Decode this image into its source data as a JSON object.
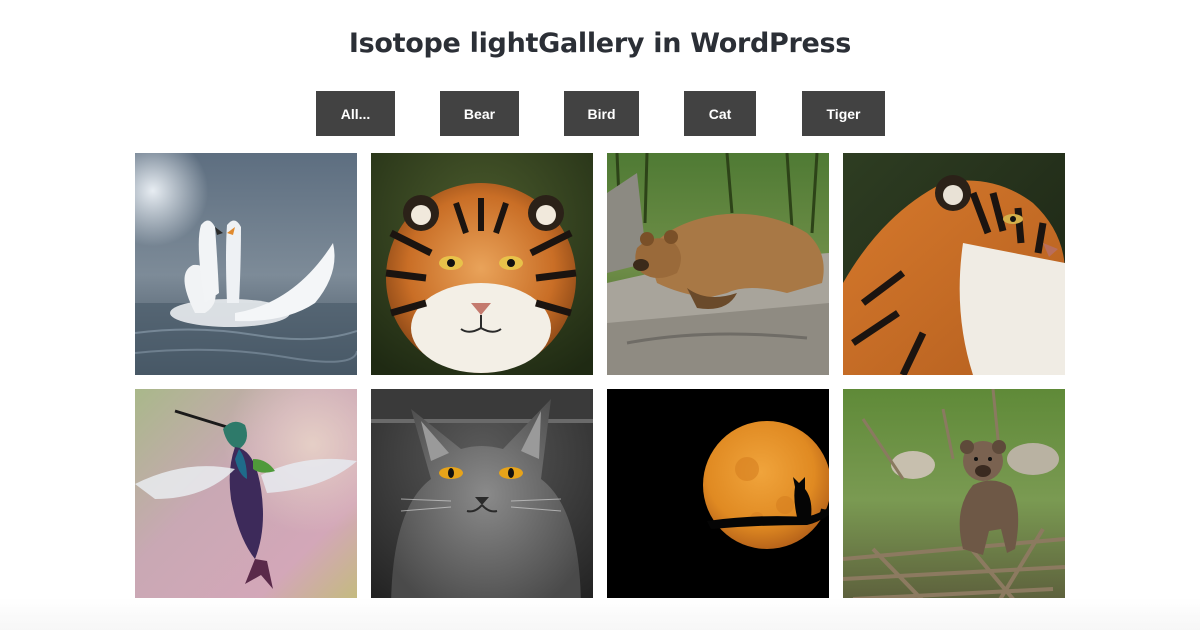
{
  "page": {
    "title": "Isotope lightGallery in WordPress"
  },
  "filters": [
    {
      "label": "All..."
    },
    {
      "label": "Bear"
    },
    {
      "label": "Bird"
    },
    {
      "label": "Cat"
    },
    {
      "label": "Tiger"
    }
  ],
  "gallery": {
    "items": [
      {
        "subject": "swans",
        "category": "Bird"
      },
      {
        "subject": "tiger face",
        "category": "Tiger"
      },
      {
        "subject": "bear on rock",
        "category": "Bear"
      },
      {
        "subject": "tiger profile",
        "category": "Tiger"
      },
      {
        "subject": "hummingbird",
        "category": "Bird"
      },
      {
        "subject": "grey cat",
        "category": "Cat"
      },
      {
        "subject": "cat silhouette moon",
        "category": "Cat"
      },
      {
        "subject": "bear cub",
        "category": "Bear"
      }
    ]
  },
  "colors": {
    "button_bg": "#424242",
    "button_text": "#ffffff",
    "title_text": "#2b2f36",
    "page_bg": "#ffffff"
  }
}
